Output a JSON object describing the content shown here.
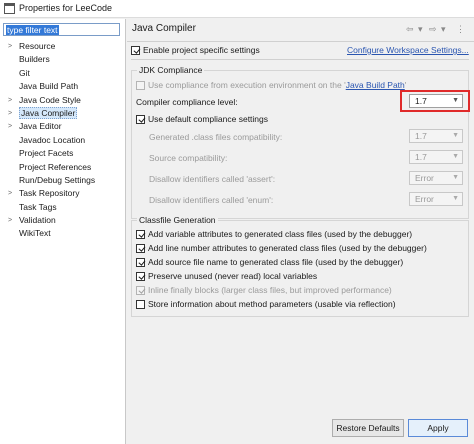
{
  "window": {
    "title": "Properties for LeeCode"
  },
  "sidebar": {
    "filter_text": "type filter text",
    "items": [
      {
        "label": "Resource",
        "expandable": true
      },
      {
        "label": "Builders",
        "expandable": false
      },
      {
        "label": "Git",
        "expandable": false
      },
      {
        "label": "Java Build Path",
        "expandable": false
      },
      {
        "label": "Java Code Style",
        "expandable": true
      },
      {
        "label": "Java Compiler",
        "expandable": true,
        "selected": true
      },
      {
        "label": "Java Editor",
        "expandable": true
      },
      {
        "label": "Javadoc Location",
        "expandable": false
      },
      {
        "label": "Project Facets",
        "expandable": false
      },
      {
        "label": "Project References",
        "expandable": false
      },
      {
        "label": "Run/Debug Settings",
        "expandable": false
      },
      {
        "label": "Task Repository",
        "expandable": true
      },
      {
        "label": "Task Tags",
        "expandable": false
      },
      {
        "label": "Validation",
        "expandable": true
      },
      {
        "label": "WikiText",
        "expandable": false
      }
    ]
  },
  "header": {
    "title": "Java Compiler",
    "nav_back": "⇦",
    "nav_forward": "⇨",
    "nav_dropdown": "▾",
    "menu": "⋮"
  },
  "main": {
    "enable_specific_label": "Enable project specific settings",
    "configure_link": "Configure Workspace Settings...",
    "jdk": {
      "group_title": "JDK Compliance",
      "use_env_prefix": "Use compliance from execution environment on the '",
      "use_env_link": "Java Build Path",
      "use_env_suffix": "'",
      "compliance_label": "Compiler compliance level:",
      "compliance_value": "1.7",
      "use_default_label": "Use default compliance settings",
      "generated_label": "Generated .class files compatibility:",
      "generated_value": "1.7",
      "source_label": "Source compatibility:",
      "source_value": "1.7",
      "assert_label": "Disallow identifiers called 'assert':",
      "assert_value": "Error",
      "enum_label": "Disallow identifiers called 'enum':",
      "enum_value": "Error"
    },
    "classfile": {
      "group_title": "Classfile Generation",
      "opt1": "Add variable attributes to generated class files (used by the debugger)",
      "opt2": "Add line number attributes to generated class files (used by the debugger)",
      "opt3": "Add source file name to generated class file (used by the debugger)",
      "opt4": "Preserve unused (never read) local variables",
      "opt5": "Inline finally blocks (larger class files, but improved performance)",
      "opt6": "Store information about method parameters (usable via reflection)"
    }
  },
  "footer": {
    "restore_label": "Restore Defaults",
    "apply_label": "Apply"
  },
  "colors": {
    "accent": "#3379d8",
    "highlight_border": "#e02a2a",
    "link": "#2a55b0"
  }
}
